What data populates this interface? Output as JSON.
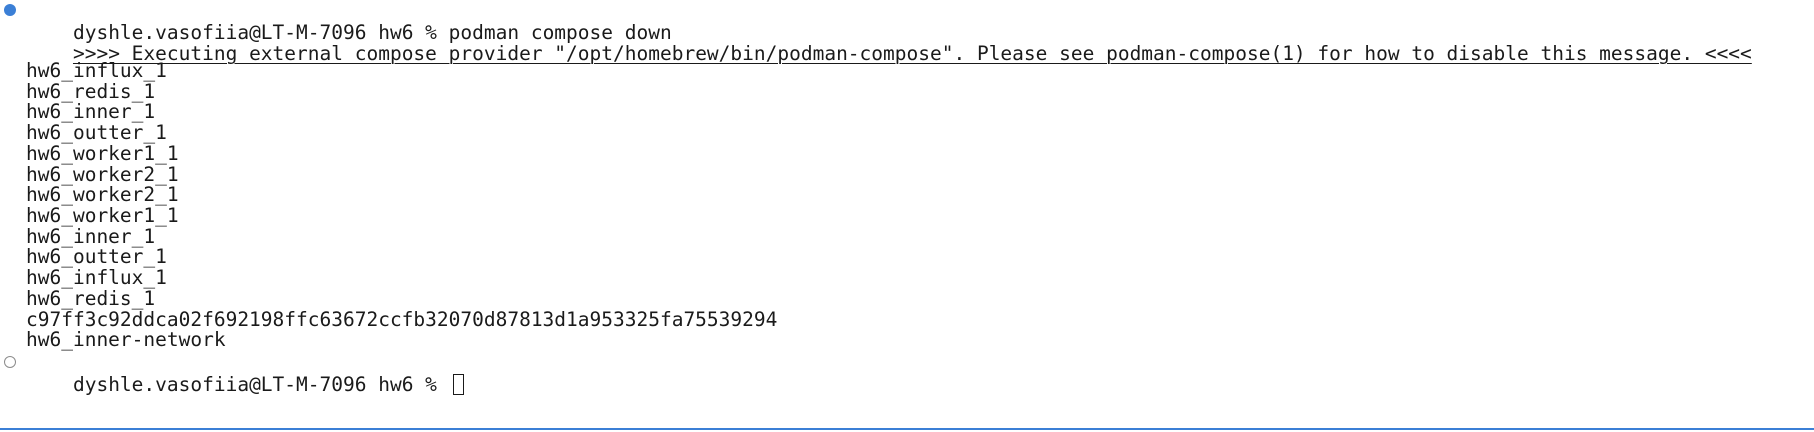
{
  "terminal": {
    "command_prompt": "dyshle.vasofiia@LT-M-7096 hw6 % podman compose down",
    "provider_message": ">>>> Executing external compose provider \"/opt/homebrew/bin/podman-compose\". Please see podman-compose(1) for how to disable this message. <<<<",
    "output_lines": [
      "hw6_influx_1",
      "hw6_redis_1",
      "hw6_inner_1",
      "hw6_outter_1",
      "hw6_worker1_1",
      "hw6_worker2_1",
      "hw6_worker2_1",
      "hw6_worker1_1",
      "hw6_inner_1",
      "hw6_outter_1",
      "hw6_influx_1",
      "hw6_redis_1",
      "c97ff3c92ddca02f692198ffc63672ccfb32070d87813d1a953325fa75539294",
      "hw6_inner-network"
    ],
    "current_prompt": "dyshle.vasofiia@LT-M-7096 hw6 % "
  },
  "colors": {
    "success_marker": "#3b7fd6",
    "pending_marker": "#8c8c8c",
    "text": "#1a1a1a",
    "background": "#ffffff"
  },
  "icons": {
    "command_status": "filled-circle-icon",
    "prompt_status": "hollow-circle-icon",
    "cursor": "block-cursor-icon"
  }
}
